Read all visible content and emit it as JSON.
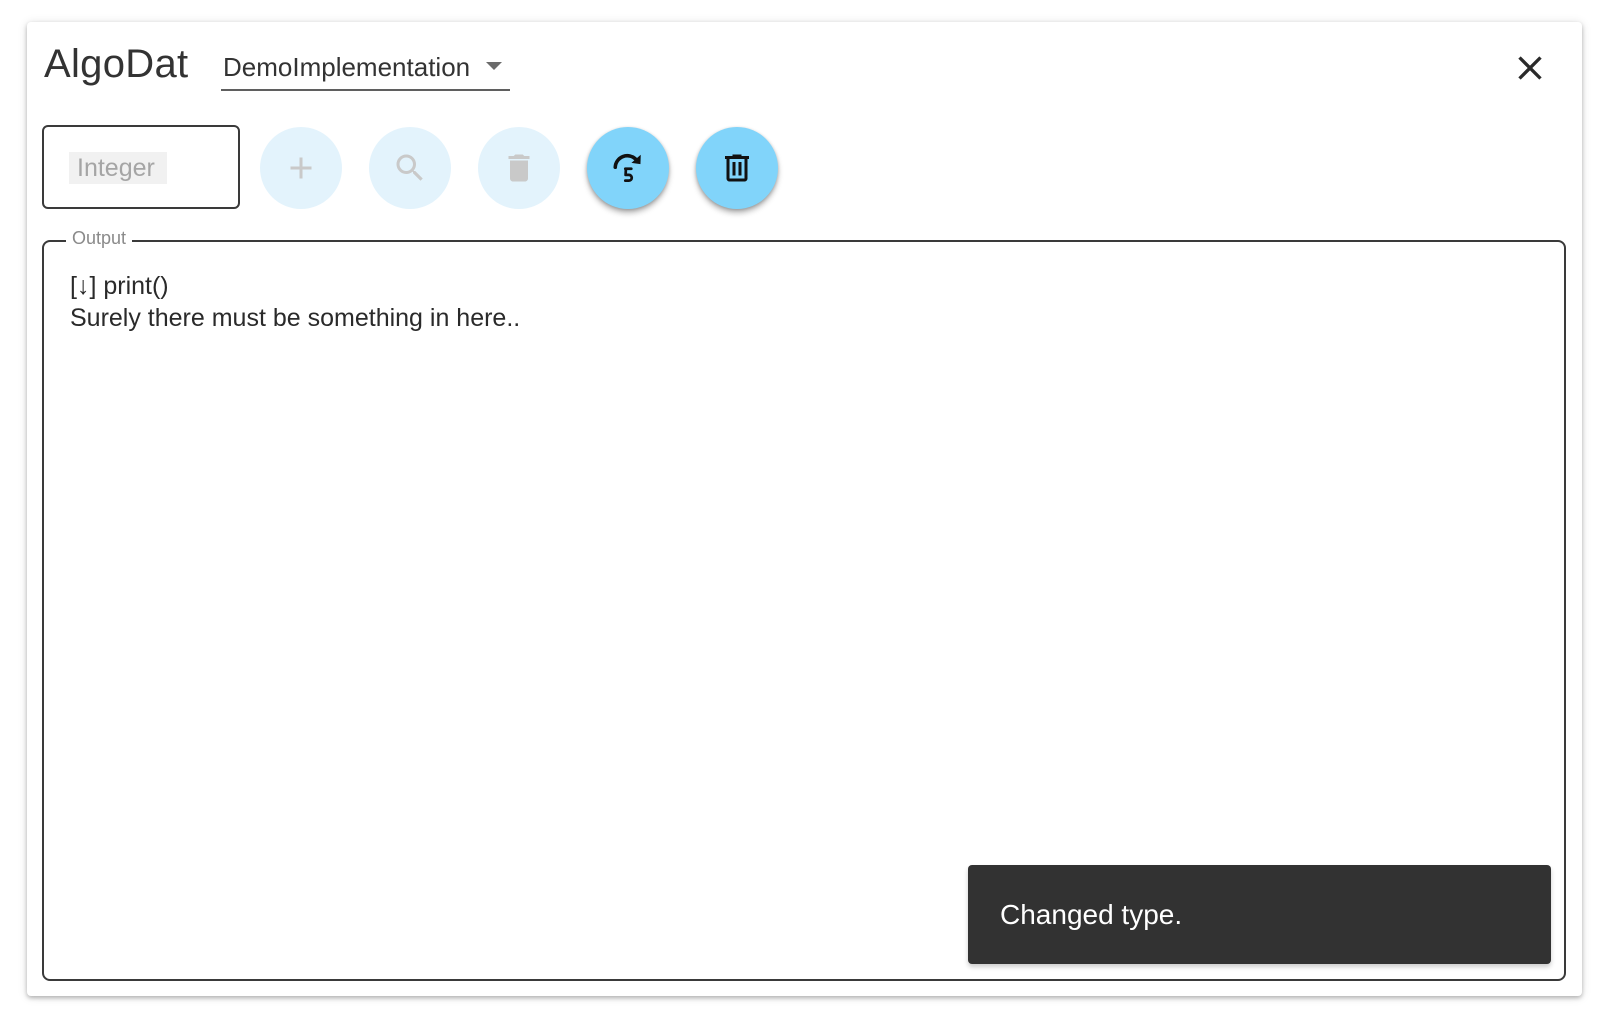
{
  "app": {
    "title": "AlgoDat",
    "implementation_select": {
      "value": "DemoImplementation"
    }
  },
  "toolbar": {
    "value_input": {
      "placeholder": "Integer"
    },
    "buttons": [
      {
        "name": "add",
        "icon": "plus-icon",
        "enabled": false
      },
      {
        "name": "search",
        "icon": "search-icon",
        "enabled": false
      },
      {
        "name": "remove",
        "icon": "delete-icon",
        "enabled": false
      },
      {
        "name": "random-insert",
        "icon": "redo-5-icon",
        "enabled": true
      },
      {
        "name": "clear",
        "icon": "trash-outline-icon",
        "enabled": true
      }
    ]
  },
  "output": {
    "label": "Output",
    "lines": [
      "[↓] print()",
      "Surely there must be something in here.."
    ]
  },
  "snackbar": {
    "message": "Changed type."
  },
  "colors": {
    "fab_enabled": "#81d4fa",
    "fab_disabled": "#e3f3fc",
    "snackbar_bg": "#323232"
  }
}
